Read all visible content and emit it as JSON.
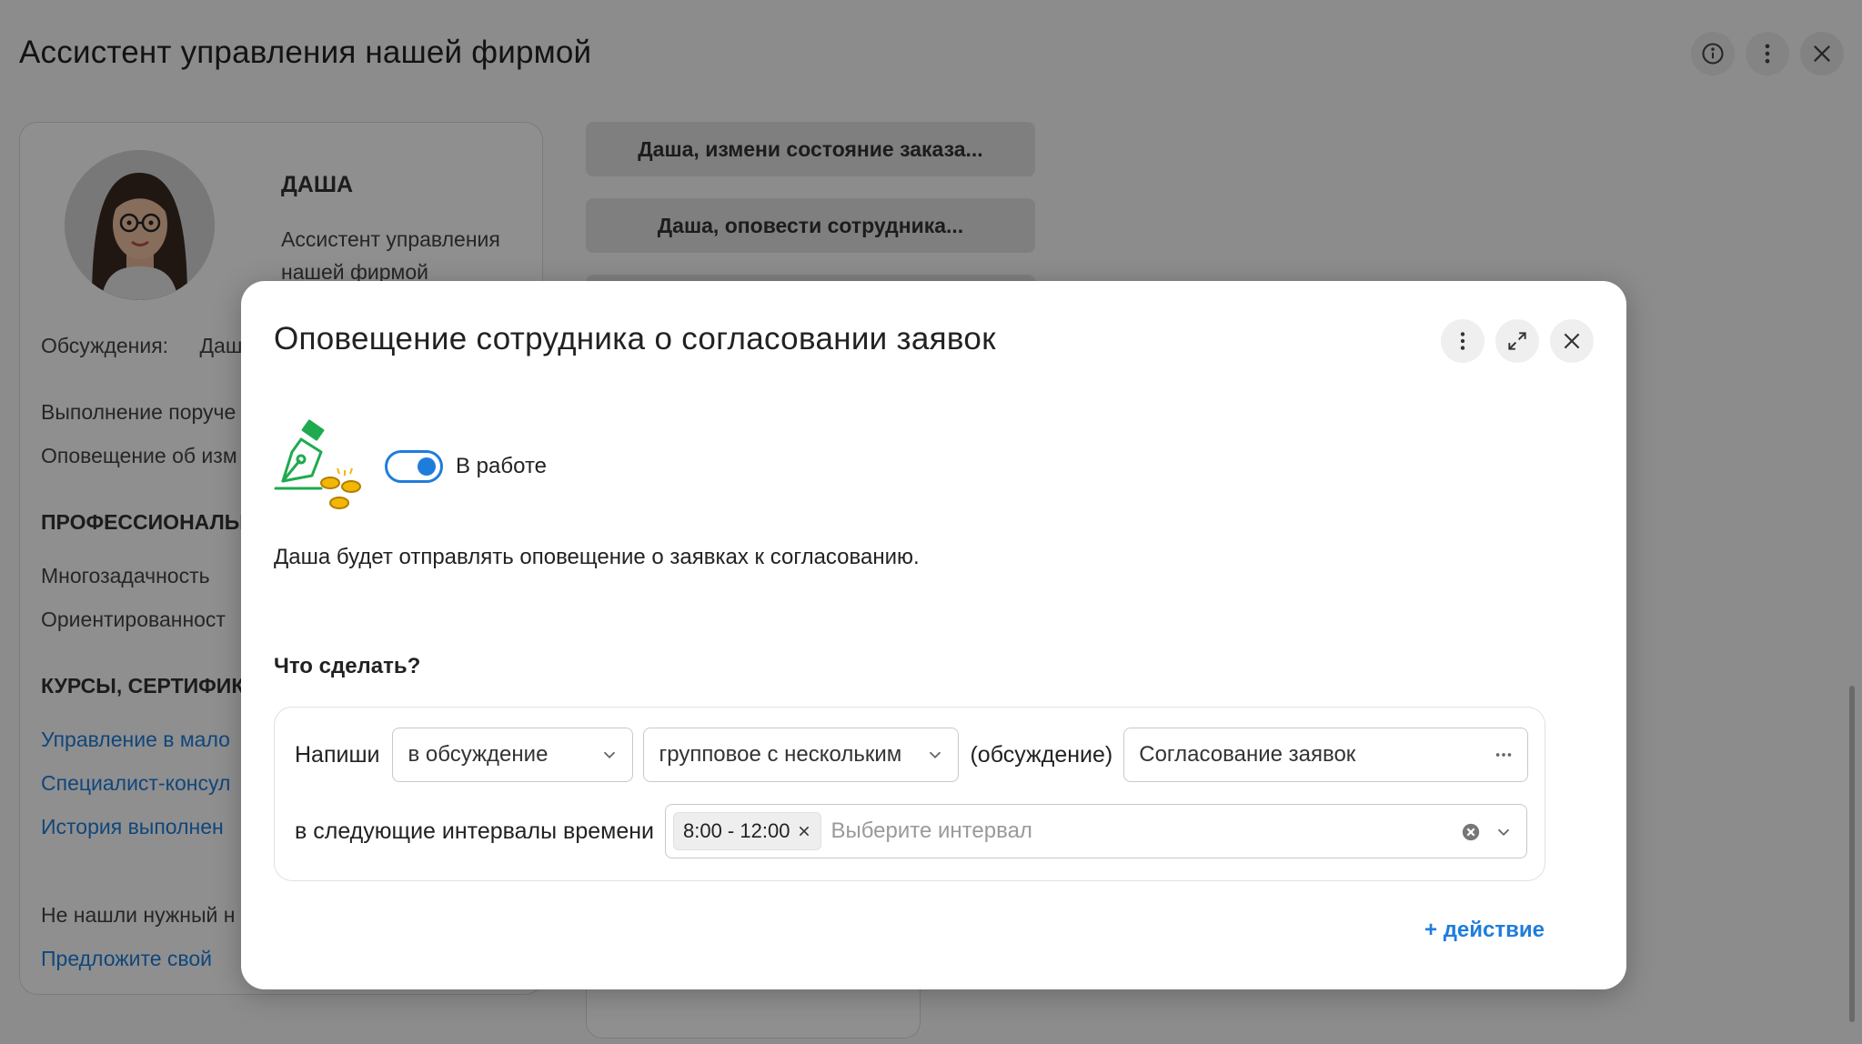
{
  "page": {
    "title": "Ассистент управления нашей фирмой",
    "actions": [
      {
        "name": "info-icon"
      },
      {
        "name": "more-vertical-icon"
      },
      {
        "name": "close-icon"
      }
    ]
  },
  "profile": {
    "name": "ДАША",
    "role": "Ассистент управления нашей фирмой",
    "discussions_label": "Обсуждения:",
    "discussions_value": "Даш",
    "tasks": [
      "Выполнение поруче",
      "Оповещение об изм"
    ],
    "professional_heading": "ПРОФЕССИОНАЛЬН",
    "skills": [
      "Многозадачность",
      "Ориентированност"
    ],
    "courses_heading": "КУРСЫ, СЕРТИФИК",
    "courses": [
      "Управление в мало",
      "Специалист-консул",
      "История выполнен"
    ],
    "not_found_text": "Не нашли нужный н",
    "suggest_link": "Предложите свой"
  },
  "scenarios": [
    "Даша, измени состояние заказа...",
    "Даша, оповести сотрудника..."
  ],
  "modal": {
    "title": "Оповещение сотрудника о согласовании заявок",
    "actions": [
      {
        "name": "more-vertical-icon"
      },
      {
        "name": "expand-icon"
      },
      {
        "name": "close-icon"
      }
    ],
    "icon": "pen-coins-icon",
    "status_toggle": {
      "label": "В работе",
      "on": true
    },
    "description": "Даша будет отправлять оповещение о заявках к согласованию.",
    "section_title": "Что сделать?",
    "action": {
      "verb": "Напиши",
      "target_select": "в обсуждение",
      "type_select": "групповое с нескольким",
      "discussion_label": "(обсуждение)",
      "discussion_value": "Согласование заявок",
      "interval_label": "в следующие интервалы времени",
      "interval_tags": [
        "8:00 - 12:00"
      ],
      "interval_placeholder": "Выберите интервал"
    },
    "add_action": "+ действие"
  },
  "colors": {
    "accent": "#1e7ddb",
    "overlay": "rgba(0,0,0,0.44)",
    "icon_green": "#1faa4f",
    "icon_coin": "#f2b705"
  }
}
